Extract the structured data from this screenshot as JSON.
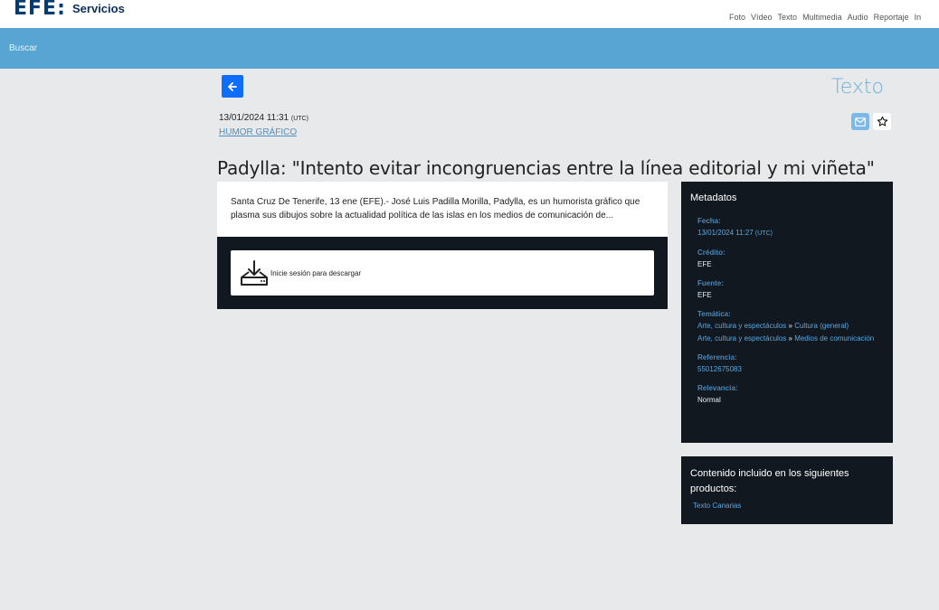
{
  "header": {
    "logo": "EFE:",
    "subtitle": "Servicios",
    "nav": [
      "Foto",
      "Vídeo",
      "Texto",
      "Multimedia",
      "Audio",
      "Reportaje",
      "In"
    ]
  },
  "search": {
    "label": "Buscar"
  },
  "article": {
    "type_label": "Texto",
    "date": "13/01/2024 11:31",
    "timezone": "(UTC)",
    "category": "HUMOR GRÁFICO",
    "headline": "Padylla: \"Intento evitar incongruencias entre la línea editorial y mi viñeta\"",
    "summary": "Santa Cruz De Tenerife, 13 ene (EFE).- José Luis Padilla Morilla, Padylla, es un humorista gráfico que plasma sus dibujos sobre la actualidad política de las islas en los medios de comunicación de...",
    "download_label": "Inicie sesión para descargar"
  },
  "metadata": {
    "title": "Metadatos",
    "fecha_label": "Fecha:",
    "fecha_value": "13/01/2024 11:27",
    "fecha_tz": "(UTC)",
    "credito_label": "Crédito:",
    "credito_value": "EFE",
    "fuente_label": "Fuente:",
    "fuente_value": "EFE",
    "tematica_label": "Temática:",
    "tematica_1a": "Arte, cultura y espectáculos",
    "tematica_1sep": " » ",
    "tematica_1b": "Cultura (general)",
    "tematica_2a": "Arte, cultura y espectáculos",
    "tematica_2sep": " » ",
    "tematica_2b": "Medios de comunicación",
    "referencia_label": "Referencia:",
    "referencia_value": "55012675083",
    "relevancia_label": "Relevancia:",
    "relevancia_value": "Normal"
  },
  "products": {
    "title": "Contenido incluido en los siguientes productos:",
    "link": "Texto Canarias"
  },
  "icons": {
    "back": "arrow-left-icon",
    "mail": "mail-icon",
    "star": "star-icon",
    "download": "download-tray-icon"
  },
  "colors": {
    "brand_blue": "#003c71",
    "search_band": "#58a5d4",
    "accent_button": "#0d6efd",
    "dark_panel": "#111820"
  }
}
